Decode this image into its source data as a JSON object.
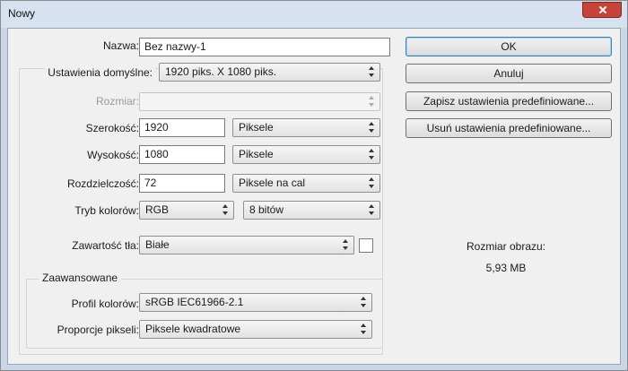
{
  "window": {
    "title": "Nowy"
  },
  "form": {
    "name_label": "Nazwa:",
    "name_value": "Bez nazwy-1",
    "preset_label": "Ustawienia domyślne:",
    "preset_value": "1920 piks. X 1080 piks.",
    "size_label": "Rozmiar:",
    "size_value": "",
    "width_label": "Szerokość:",
    "width_value": "1920",
    "width_unit": "Piksele",
    "height_label": "Wysokość:",
    "height_value": "1080",
    "height_unit": "Piksele",
    "resolution_label": "Rozdzielczość:",
    "resolution_value": "72",
    "resolution_unit": "Piksele na cal",
    "color_mode_label": "Tryb kolorów:",
    "color_mode_value": "RGB",
    "bit_depth_value": "8 bitów",
    "background_label": "Zawartość tła:",
    "background_value": "Białe",
    "background_swatch_color": "#ffffff"
  },
  "advanced": {
    "title": "Zaawansowane",
    "color_profile_label": "Profil kolorów:",
    "color_profile_value": "sRGB IEC61966-2.1",
    "pixel_aspect_label": "Proporcje pikseli:",
    "pixel_aspect_value": "Piksele kwadratowe"
  },
  "buttons": {
    "ok": "OK",
    "cancel": "Anuluj",
    "save_preset": "Zapisz ustawienia predefiniowane...",
    "delete_preset": "Usuń ustawienia predefiniowane..."
  },
  "image_size": {
    "label": "Rozmiar obrazu:",
    "value": "5,93 MB"
  },
  "colors": {
    "close_button": "#c7443a",
    "title_bar": "#d6e2f0",
    "client_bg": "#f0f0f0"
  }
}
